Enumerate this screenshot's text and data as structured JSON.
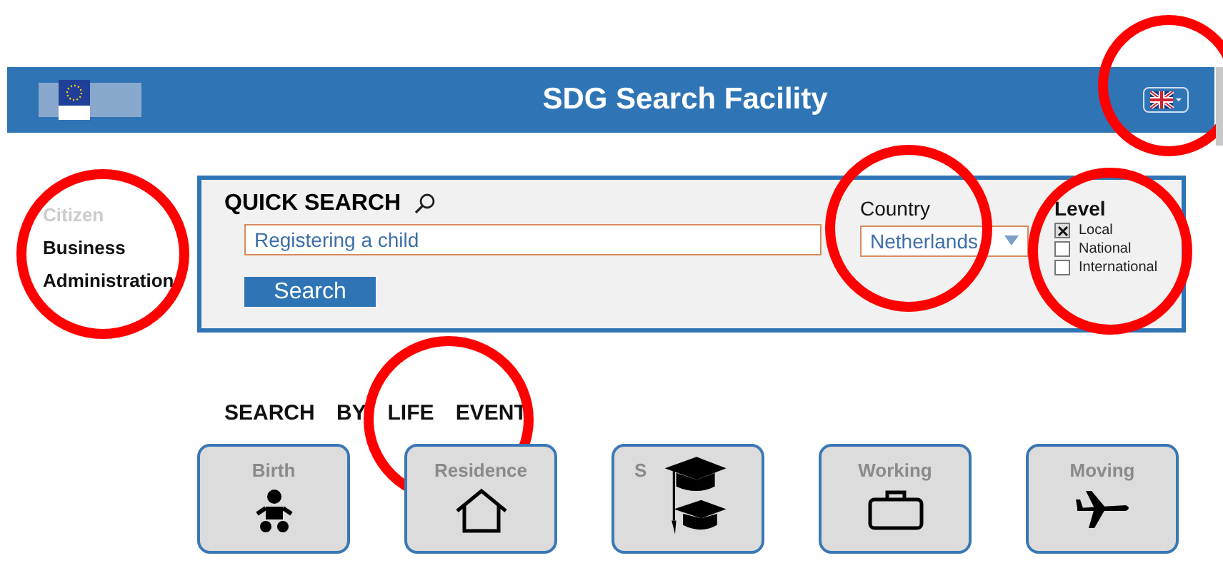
{
  "header": {
    "title": "SDG Search Facility",
    "language_button": {
      "highlighted": true
    }
  },
  "sidebar": {
    "highlighted": true,
    "items": [
      {
        "label": "Citizen",
        "selected": false
      },
      {
        "label": "Business",
        "selected": true
      },
      {
        "label": "Administration",
        "selected": true
      }
    ]
  },
  "quick_search": {
    "title": "QUICK SEARCH",
    "query": "Registering a child",
    "button": "Search",
    "country": {
      "label": "Country",
      "value": "Netherlands",
      "highlighted": true
    },
    "level": {
      "label": "Level",
      "highlighted": true,
      "options": [
        {
          "label": "Local",
          "checked": true
        },
        {
          "label": "National",
          "checked": false
        },
        {
          "label": "International",
          "checked": false
        }
      ]
    }
  },
  "life_events": {
    "title": "SEARCH BY LIFE EVENT",
    "highlighted": true,
    "tiles": [
      {
        "label": "Birth"
      },
      {
        "label": "Residence"
      },
      {
        "label": "S"
      },
      {
        "label": "Working"
      },
      {
        "label": "Moving"
      }
    ]
  }
}
